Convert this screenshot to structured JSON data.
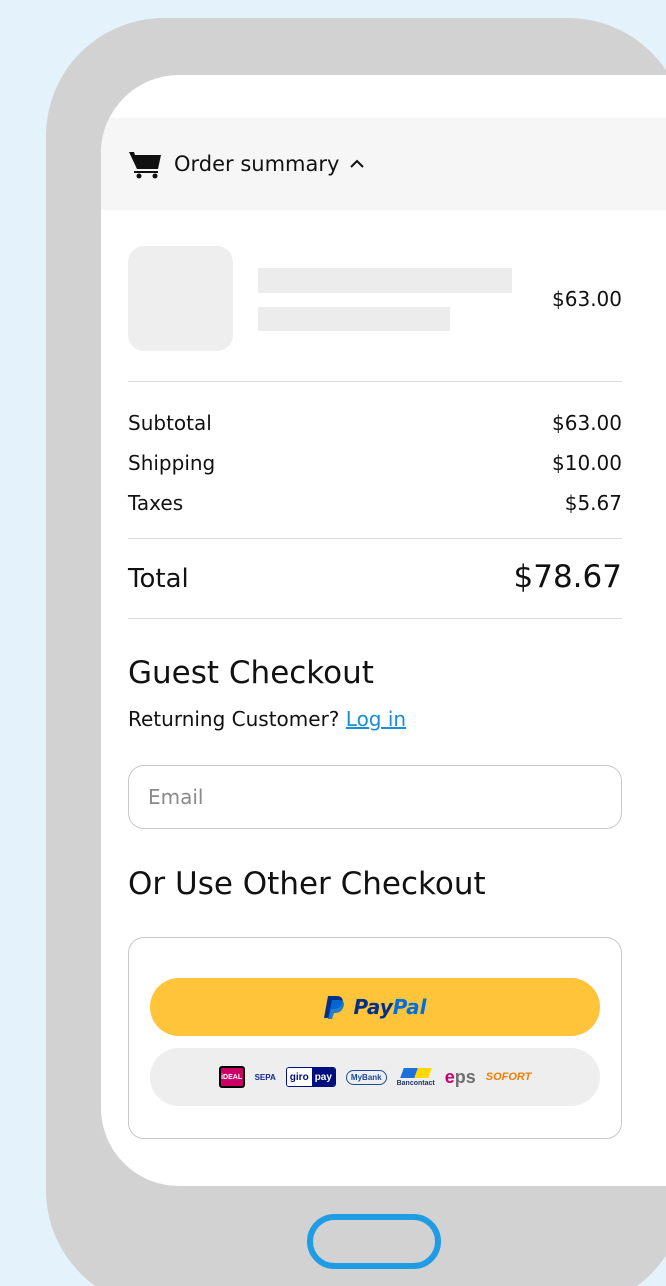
{
  "colors": {
    "background": "#e4f2fb",
    "phone_frame": "#d2d2d2",
    "link": "#1a8fd6",
    "paypal_yellow": "#ffc439",
    "paypal_dark": "#003087",
    "paypal_light": "#0070e0",
    "home_button": "#1f9ce4"
  },
  "summary": {
    "icon": "cart-icon",
    "label": "Order summary",
    "toggle_icon": "chevron-up-icon"
  },
  "product": {
    "price": "$63.00"
  },
  "totals": {
    "subtotal_label": "Subtotal",
    "subtotal_value": "$63.00",
    "shipping_label": "Shipping",
    "shipping_value": "$10.00",
    "taxes_label": "Taxes",
    "taxes_value": "$5.67",
    "total_label": "Total",
    "total_value": "$78.67"
  },
  "guest": {
    "title": "Guest Checkout",
    "returning_text": "Returning Customer?",
    "login_link": "Log in",
    "email_placeholder": "Email"
  },
  "other": {
    "title": "Or Use Other Checkout",
    "paypal_pay": "Pay",
    "paypal_pal": "Pal",
    "payment_methods": {
      "ideal": "iDEAL",
      "sepa": "SEPA",
      "giro": "giro",
      "gpay": "pay",
      "mybank": "MyBank",
      "bancontact": "Bancontact",
      "eps_e": "e",
      "eps_rest": "ps",
      "sofort": "SOFORT"
    }
  }
}
